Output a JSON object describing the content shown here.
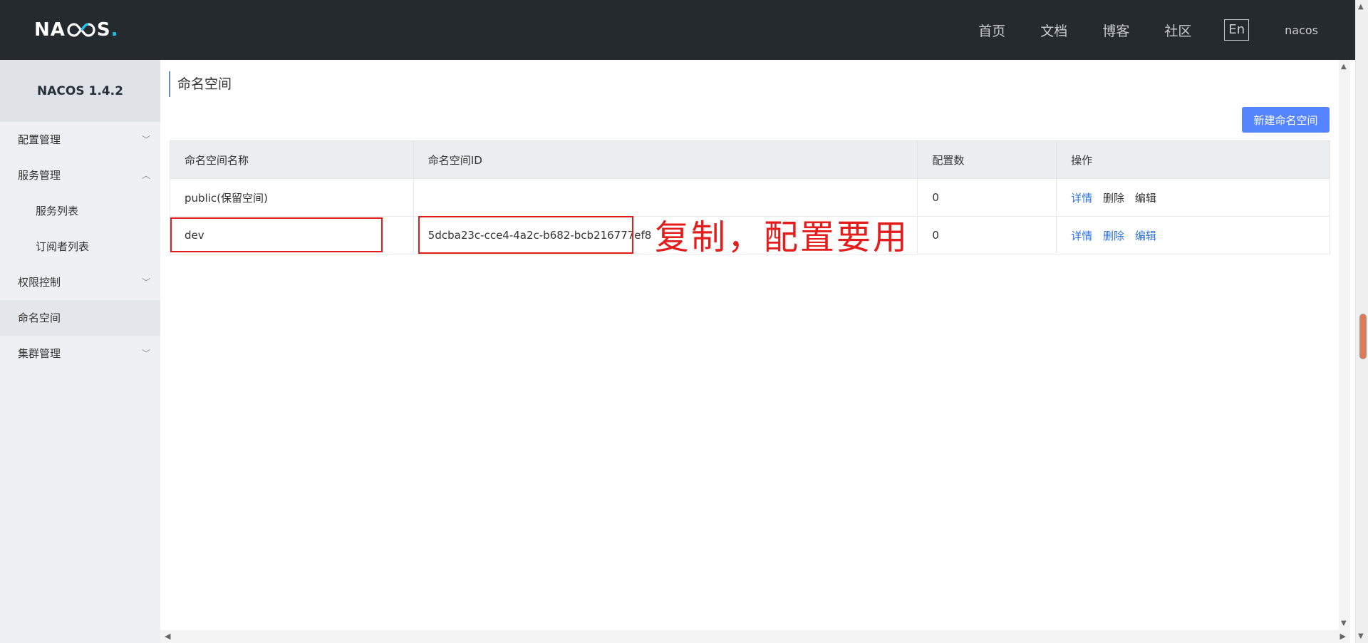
{
  "header": {
    "logo": "NACOS",
    "nav": [
      "首页",
      "文档",
      "博客",
      "社区"
    ],
    "lang": "En",
    "user": "nacos"
  },
  "sidebar": {
    "brand": "NACOS 1.4.2",
    "items": [
      {
        "label": "配置管理",
        "chevron": "chevron-down"
      },
      {
        "label": "服务管理",
        "chevron": "chevron-up"
      },
      {
        "label": "服务列表"
      },
      {
        "label": "订阅者列表"
      },
      {
        "label": "权限控制",
        "chevron": "chevron-down"
      },
      {
        "label": "命名空间",
        "active": true
      },
      {
        "label": "集群管理",
        "chevron": "chevron-down"
      }
    ]
  },
  "page": {
    "title": "命名空间",
    "new_button": "新建命名空间"
  },
  "table": {
    "columns": [
      "命名空间名称",
      "命名空间ID",
      "配置数",
      "操作"
    ],
    "rows": [
      {
        "name": "public(保留空间)",
        "id": "",
        "count": "0",
        "ops": [
          "详情",
          "删除",
          "编辑"
        ]
      },
      {
        "name": "dev",
        "id": "5dcba23c-cce4-4a2c-b682-bcb216777ef8",
        "count": "0",
        "ops": [
          "详情",
          "删除",
          "编辑"
        ]
      }
    ]
  },
  "annotation": "复制，配置要用",
  "colors": {
    "accent": "#5584ff",
    "header_bg": "#252a2f",
    "link": "#2b71d9",
    "annotation": "#e31c1c"
  }
}
